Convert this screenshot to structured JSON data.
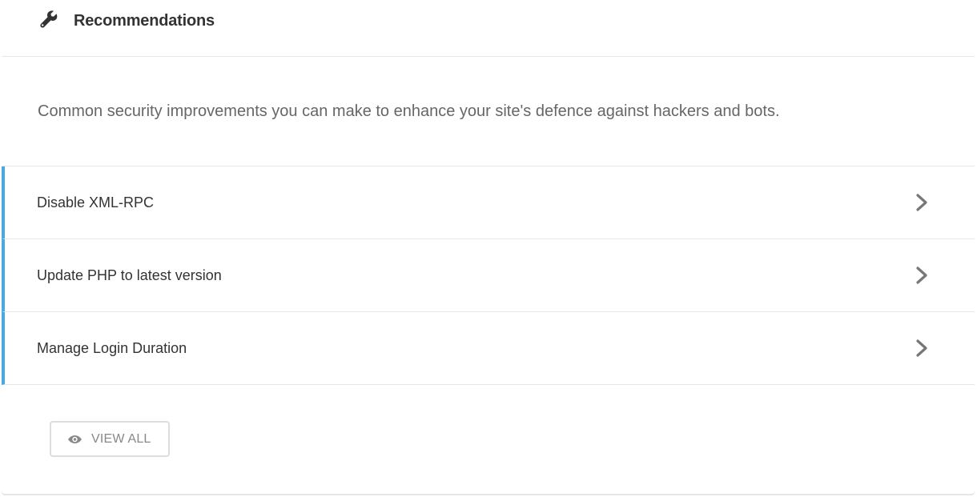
{
  "header": {
    "icon": "wrench-icon",
    "title": "Recommendations"
  },
  "description": "Common security improvements you can make to enhance your site's defence against hackers and bots.",
  "recommendations": {
    "accent_color": "#4aa7e0",
    "items": [
      {
        "label": "Disable XML-RPC",
        "icon": "chevron-right-icon"
      },
      {
        "label": "Update PHP to latest version",
        "icon": "chevron-right-icon"
      },
      {
        "label": "Manage Login Duration",
        "icon": "chevron-right-icon"
      }
    ]
  },
  "view_all": {
    "icon": "eye-icon",
    "label": "VIEW ALL"
  }
}
